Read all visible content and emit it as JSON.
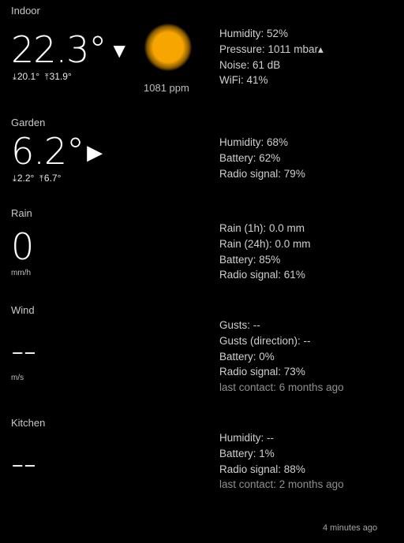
{
  "indoor": {
    "name": "Indoor",
    "temperature": "22.3°",
    "trend_glyph": "▼",
    "min_glyph": "⤓",
    "min": "20.1°",
    "max_glyph": "⤒",
    "max": "31.9°",
    "co2": "1081 ppm",
    "co2_color": "#f7a500",
    "details": {
      "humidity": "Humidity: 52%",
      "pressure": "Pressure: 1011 mbar▴",
      "noise": "Noise: 61 dB",
      "wifi": "WiFi: 41%"
    }
  },
  "garden": {
    "name": "Garden",
    "temperature": "6.2°",
    "trend_glyph": "▶",
    "min_glyph": "⤓",
    "min": "2.2°",
    "max_glyph": "⤒",
    "max": "6.7°",
    "details": {
      "humidity": "Humidity: 68%",
      "battery": "Battery: 62%",
      "radio": "Radio signal: 79%"
    }
  },
  "rain": {
    "name": "Rain",
    "value": "0",
    "unit": "mm/h",
    "details": {
      "rain_1h": "Rain (1h): 0.0 mm",
      "rain_24h": "Rain (24h): 0.0 mm",
      "battery": "Battery: 85%",
      "radio": "Radio signal: 61%"
    }
  },
  "wind": {
    "name": "Wind",
    "value": "--",
    "unit": "m/s",
    "details": {
      "gusts": "Gusts: --",
      "gusts_direction": "Gusts (direction): --",
      "battery": "Battery: 0%",
      "radio": "Radio signal: 73%",
      "last_contact": "last contact: 6 months ago"
    }
  },
  "kitchen": {
    "name": "Kitchen",
    "value": "--",
    "details": {
      "humidity": "Humidity: --",
      "battery": "Battery: 1%",
      "radio": "Radio signal: 88%",
      "last_contact": "last contact: 2 months ago"
    }
  },
  "footer": {
    "updated": "4 minutes ago"
  }
}
